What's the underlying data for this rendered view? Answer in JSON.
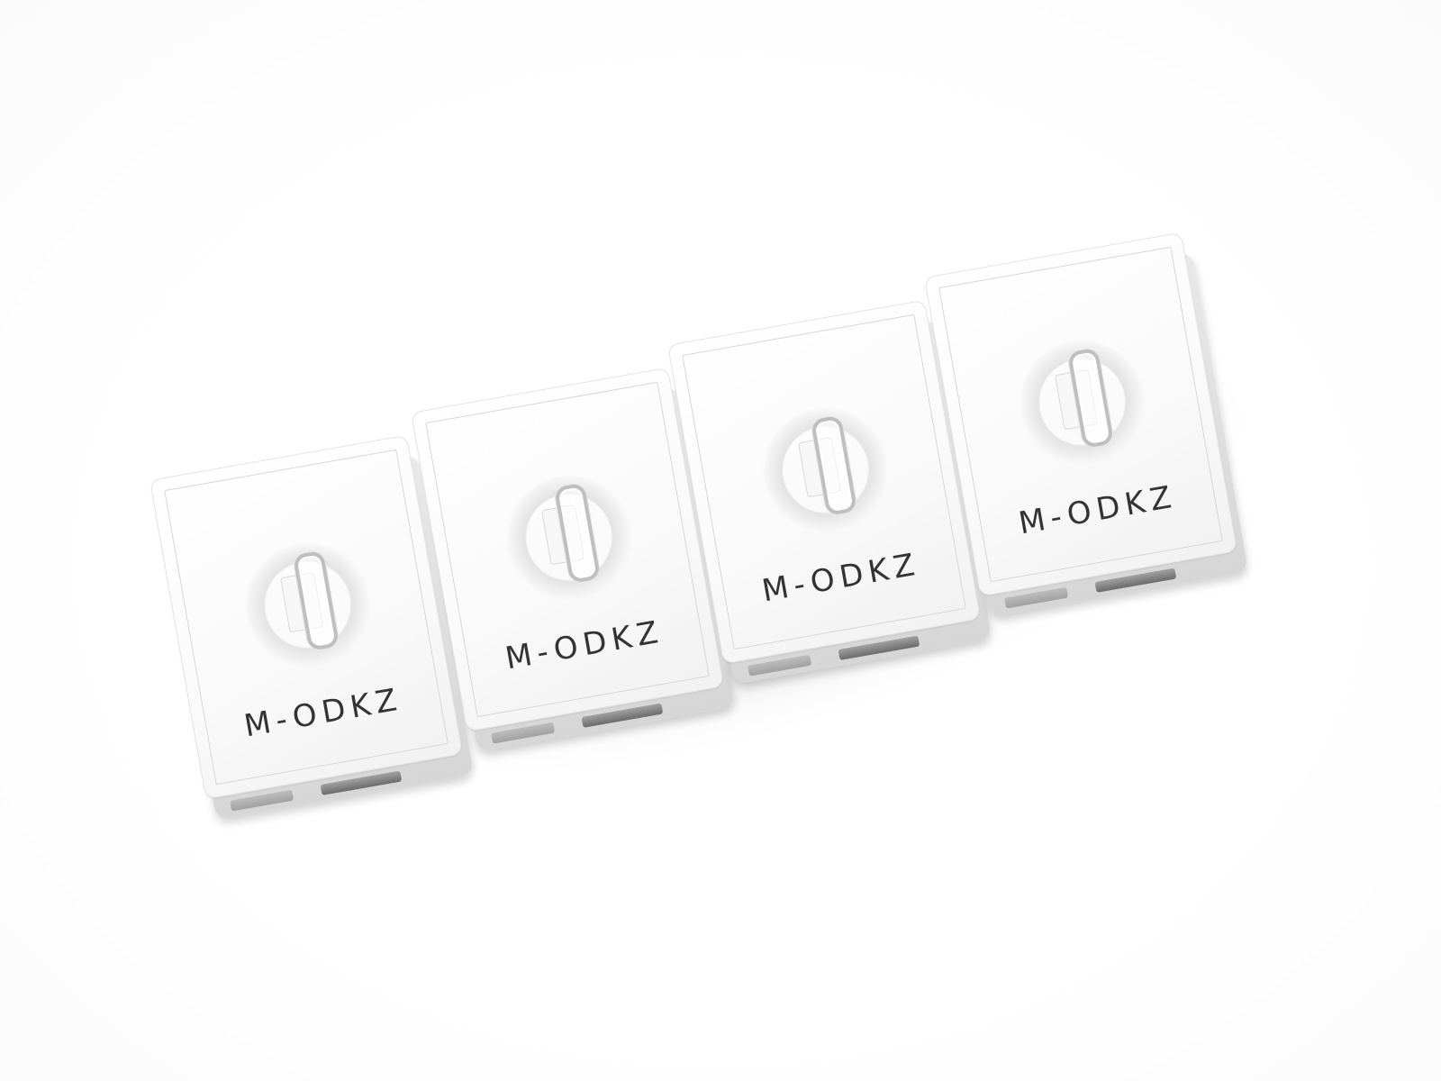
{
  "image": {
    "background": "#ffffff",
    "modules": [
      {
        "label": "M-ODKZ"
      },
      {
        "label": "M-ODKZ"
      },
      {
        "label": "M-ODKZ"
      },
      {
        "label": "M-ODKZ"
      }
    ]
  }
}
